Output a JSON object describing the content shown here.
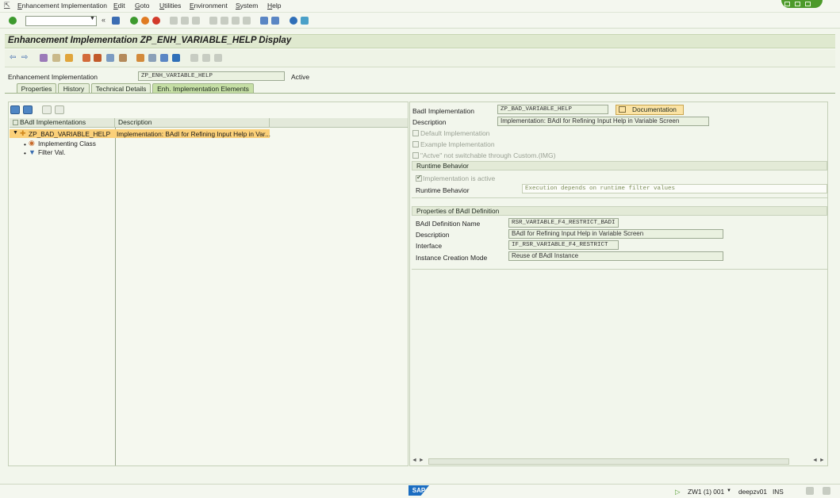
{
  "menu": [
    "Enhancement Implementation",
    "Edit",
    "Goto",
    "Utilities",
    "Environment",
    "System",
    "Help"
  ],
  "title": "Enhancement Implementation ZP_ENH_VARIABLE_HELP Display",
  "header": {
    "label": "Enhancement Implementation",
    "value": "ZP_ENH_VARIABLE_HELP",
    "status": "Active"
  },
  "tabs": [
    "Properties",
    "History",
    "Technical Details",
    "Enh. Implementation Elements"
  ],
  "active_tab": "Enh. Implementation Elements",
  "tree": {
    "col1": "BAdI Implementations",
    "col2": "Description",
    "root": {
      "name": "ZP_BAD_VARIABLE_HELP",
      "description": "Implementation: BAdI for Refining Input Help in Var...",
      "children": [
        "Implementing Class",
        "Filter Val."
      ]
    }
  },
  "details": {
    "badi_impl_label": "BadI Implementation",
    "badi_impl_value": "ZP_BAD_VARIABLE_HELP",
    "doc_button": "Documentation",
    "desc_label": "Description",
    "desc_value": "Implementation: BAdI for Refining Input Help in Variable Screen",
    "chk_default": "Default Implementation",
    "chk_example": "Example Implementation",
    "chk_custom": "\"Actve\" not switchable through Custom.(IMG)",
    "runtime_group": "Runtime Behavior",
    "chk_active": "Implementation is active",
    "runtime_label": "Runtime Behavior",
    "runtime_value": "Execution depends on runtime filter values",
    "props_group": "Properties of BAdI Definition",
    "def_name_label": "BAdI Definition Name",
    "def_name_value": "RSR_VARIABLE_F4_RESTRICT_BADI",
    "def_desc_label": "Description",
    "def_desc_value": "BAdI for Refining Input Help in Variable Screen",
    "interface_label": "Interface",
    "interface_value": "IF_RSR_VARIABLE_F4_RESTRICT",
    "instance_label": "Instance Creation Mode",
    "instance_value": "Reuse of BAdI Instance"
  },
  "status": {
    "logo": "SAP",
    "system": "ZW1 (1) 001",
    "host": "deepzv01",
    "mode": "INS"
  },
  "colors": {
    "accent": "#4c9a2a",
    "selection": "#fbd079",
    "title_bg": "#dfe9cf"
  }
}
